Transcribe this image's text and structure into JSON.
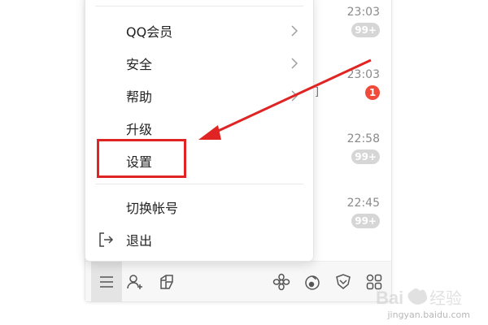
{
  "chat_list": {
    "items": [
      {
        "time": "23:03",
        "badge": "99+"
      },
      {
        "time": "23:03",
        "badge": "1"
      },
      {
        "time": "22:58",
        "badge": "99+"
      },
      {
        "time": "22:45",
        "badge": "99+"
      }
    ],
    "partial_text": "]"
  },
  "menu": {
    "items": [
      {
        "label": "QQ会员",
        "has_submenu": true
      },
      {
        "label": "安全",
        "has_submenu": true
      },
      {
        "label": "帮助",
        "has_submenu": true
      },
      {
        "label": "升级",
        "has_submenu": false
      },
      {
        "label": "设置",
        "has_submenu": false
      },
      {
        "label": "切换帐号",
        "has_submenu": false
      },
      {
        "label": "退出",
        "has_submenu": false
      }
    ]
  },
  "toolbar": {
    "buttons": [
      {
        "icon": "menu-icon"
      },
      {
        "icon": "add-contact-icon"
      },
      {
        "icon": "app-manager-icon"
      },
      {
        "icon": "flower-icon"
      },
      {
        "icon": "music-icon"
      },
      {
        "icon": "shield-icon"
      },
      {
        "icon": "grid-apps-icon"
      }
    ]
  },
  "annotation": {
    "color": "#e02424",
    "target": "设置"
  },
  "colors": {
    "badge_gray": "#d6d6d6",
    "badge_red": "#f04a3a",
    "accent_red": "#e02424"
  }
}
